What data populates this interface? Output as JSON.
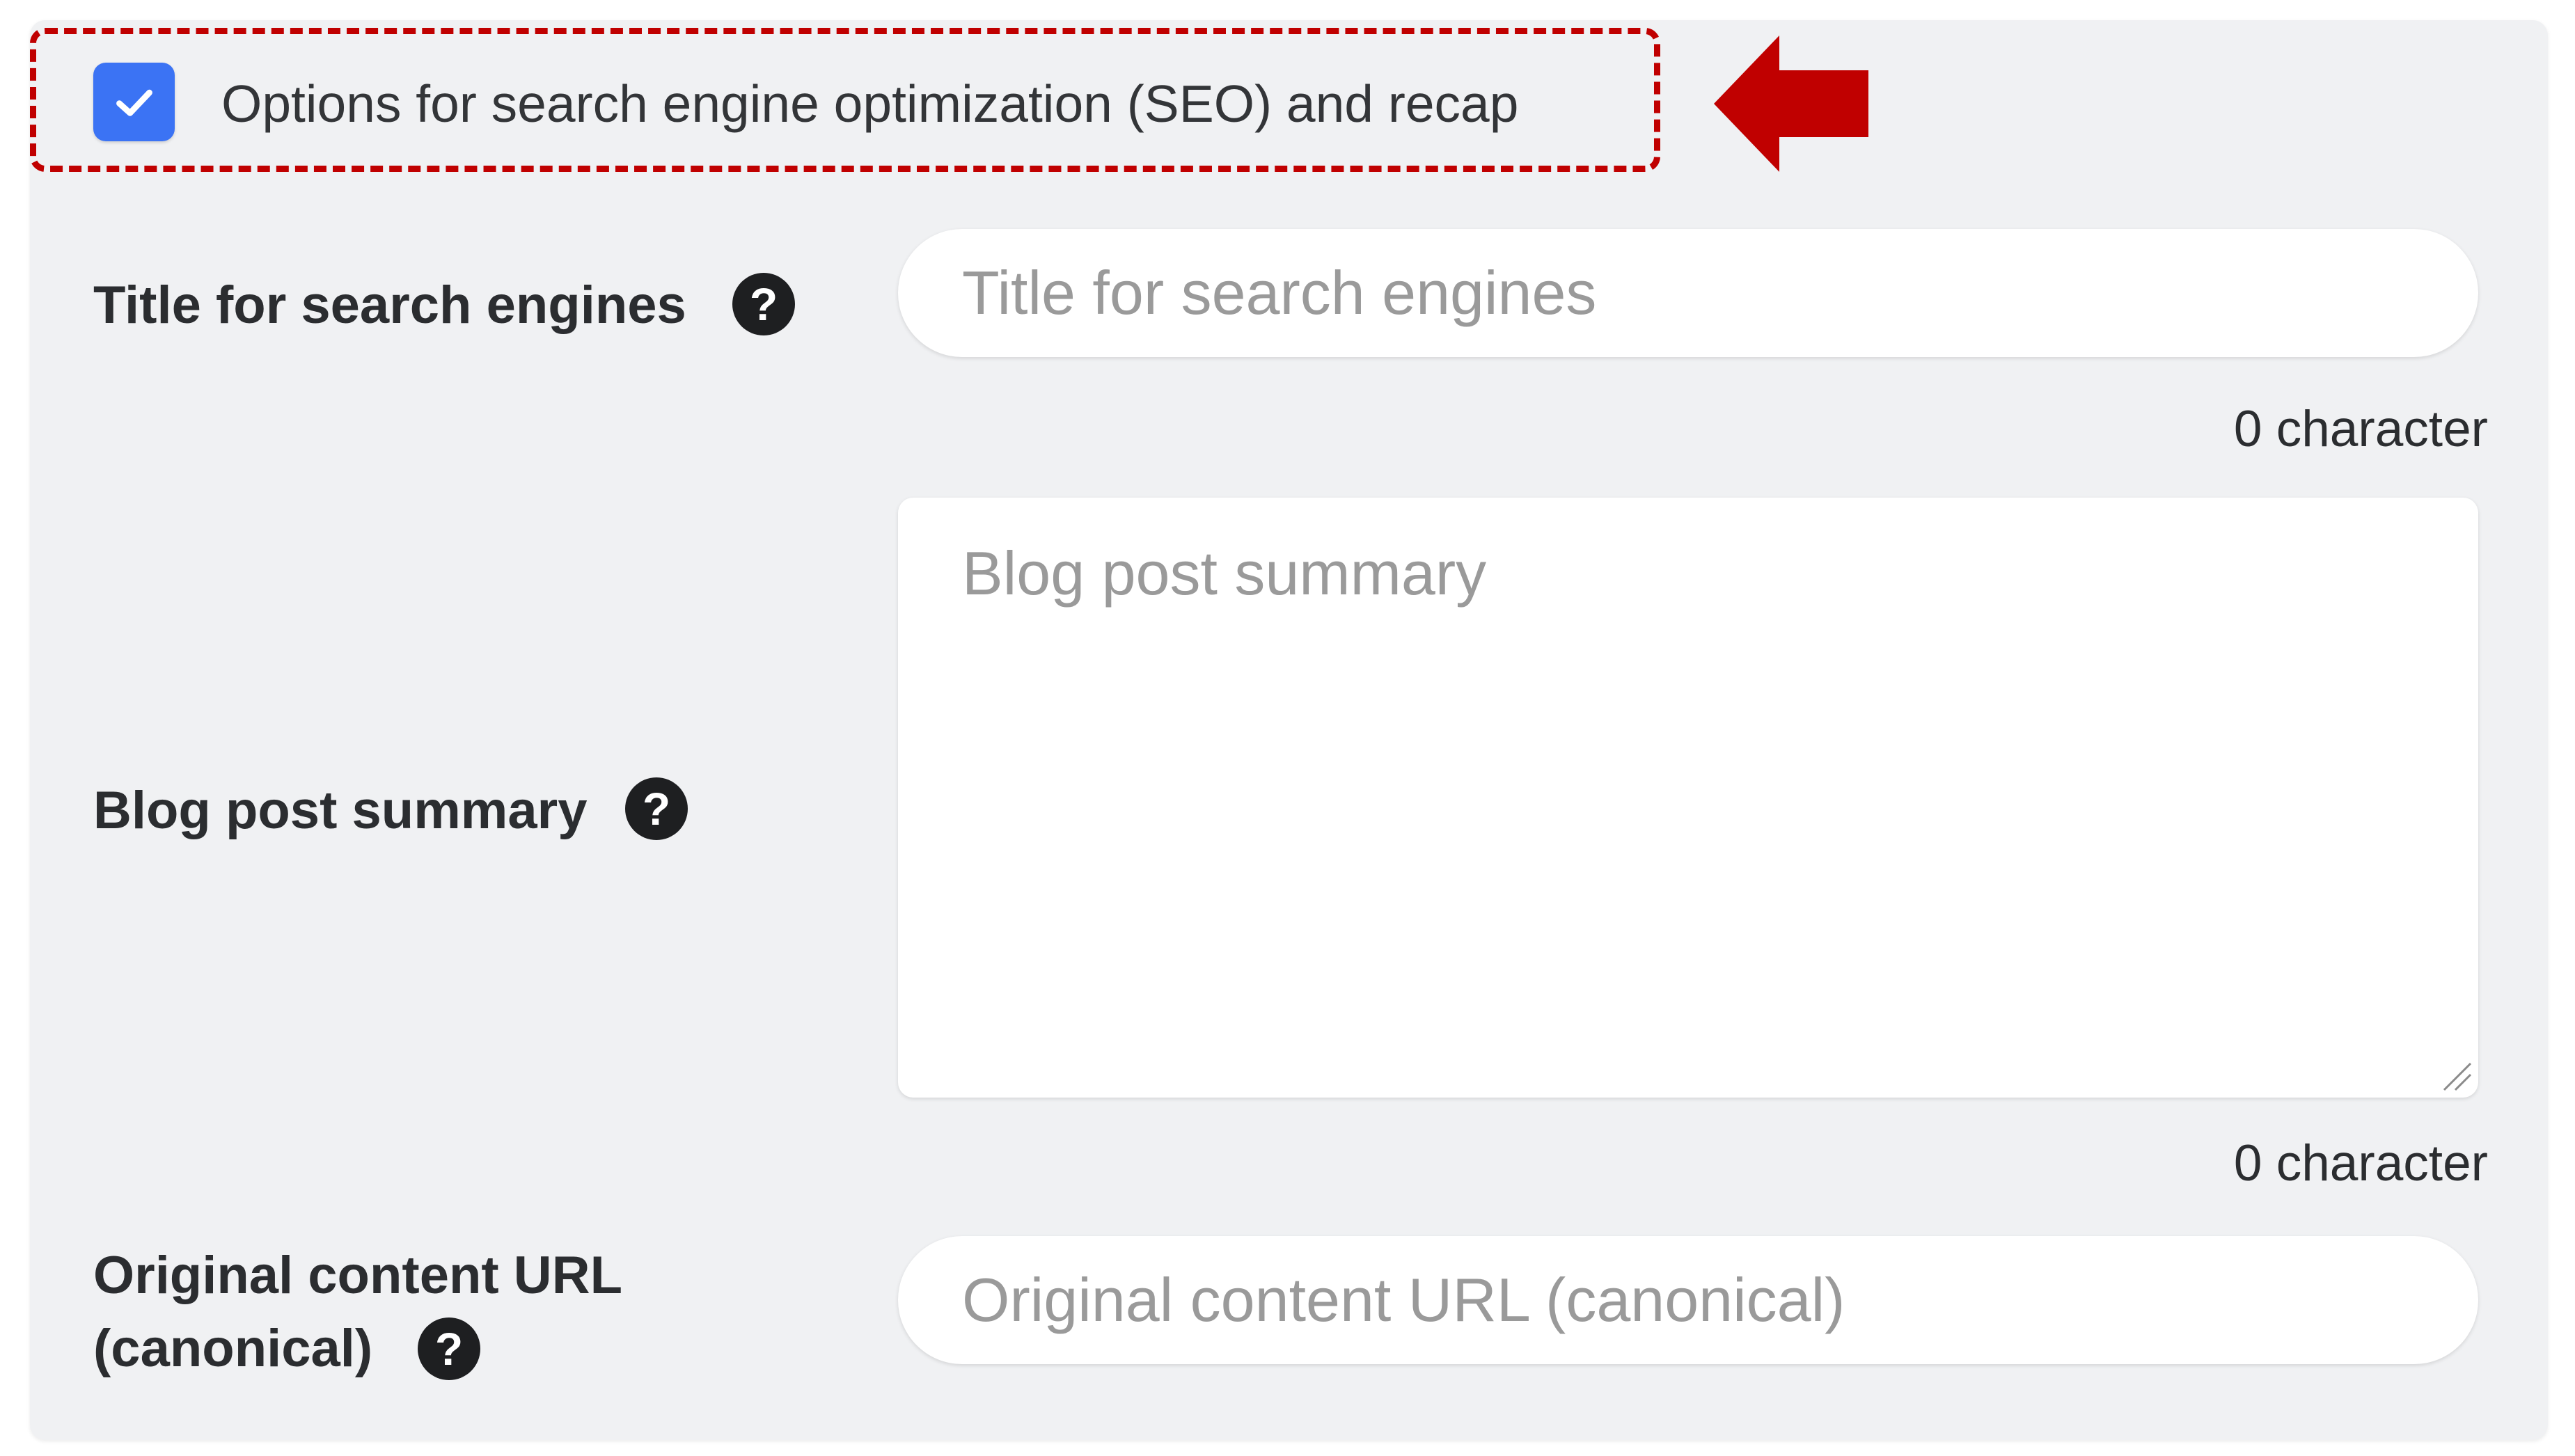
{
  "seo_toggle": {
    "label": "Options for search engine optimization (SEO) and recap",
    "checked": true
  },
  "fields": {
    "seo_title": {
      "label": "Title for search engines",
      "placeholder": "Title for search engines",
      "counter": "0 character"
    },
    "summary": {
      "label": "Blog post summary",
      "placeholder": "Blog post summary",
      "counter": "0 character"
    },
    "canonical_url": {
      "label_line1": "Original content URL",
      "label_line2": "(canonical)",
      "placeholder": "Original content URL (canonical)"
    }
  },
  "help_glyph": "?",
  "icons": [
    "check-icon",
    "help-icon",
    "arrow-left-icon",
    "resize-grip-icon"
  ],
  "colors": {
    "checkbox": "#3b73f4",
    "highlight": "#c00000",
    "panel_background": "#f0f1f3"
  }
}
